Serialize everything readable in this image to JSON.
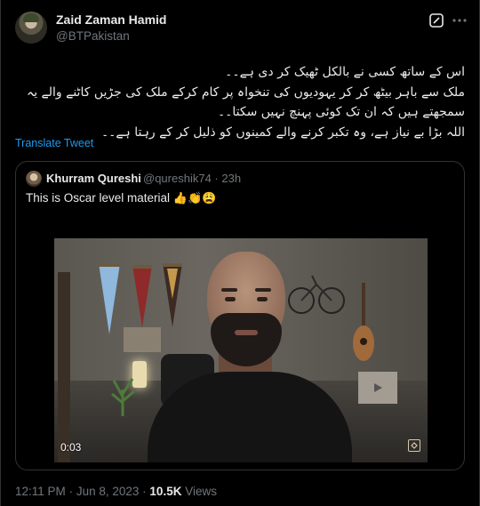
{
  "author": {
    "display_name": "Zaid Zaman Hamid",
    "handle": "@BTPakistan",
    "avatar_icon": "profile-photo"
  },
  "tweet": {
    "lines": [
      "اس کے ساتھ کسی نے بالکل ٹھیک کر دی ہے۔۔",
      "ملک سے باہر بیٹھ کر کر یہودیوں کی تنخواہ پر کام کرکے ملک کی جڑیں کاٹنے والے یہ",
      "سمجھتے ہیں کہ ان تک کوئی پہنچ نہیں سکتا۔۔",
      "اللہ بڑا بے نیاز ہے، وہ تکبر کرنے والے کمینوں کو ذلیل کر کے رہتا ہے۔۔"
    ],
    "translate_label": "Translate Tweet"
  },
  "quoted": {
    "display_name": "Khurram Qureshi",
    "handle": "@qureshik74",
    "separator": "·",
    "time_ago": "23h",
    "text": "This is Oscar level material",
    "emojis": [
      "👍",
      "👏",
      "😩"
    ],
    "video": {
      "duration": "0:03",
      "badge_icon": "gif-icon"
    }
  },
  "footer": {
    "time": "12:11 PM",
    "dot": "·",
    "date": "Jun 8, 2023",
    "dot2": "·",
    "views_count": "10.5K",
    "views_label": "Views"
  },
  "colors": {
    "background": "#000000",
    "text": "#e7e9ea",
    "secondary": "#71767b",
    "accent": "#1d9bf0",
    "border": "#2f3336"
  }
}
